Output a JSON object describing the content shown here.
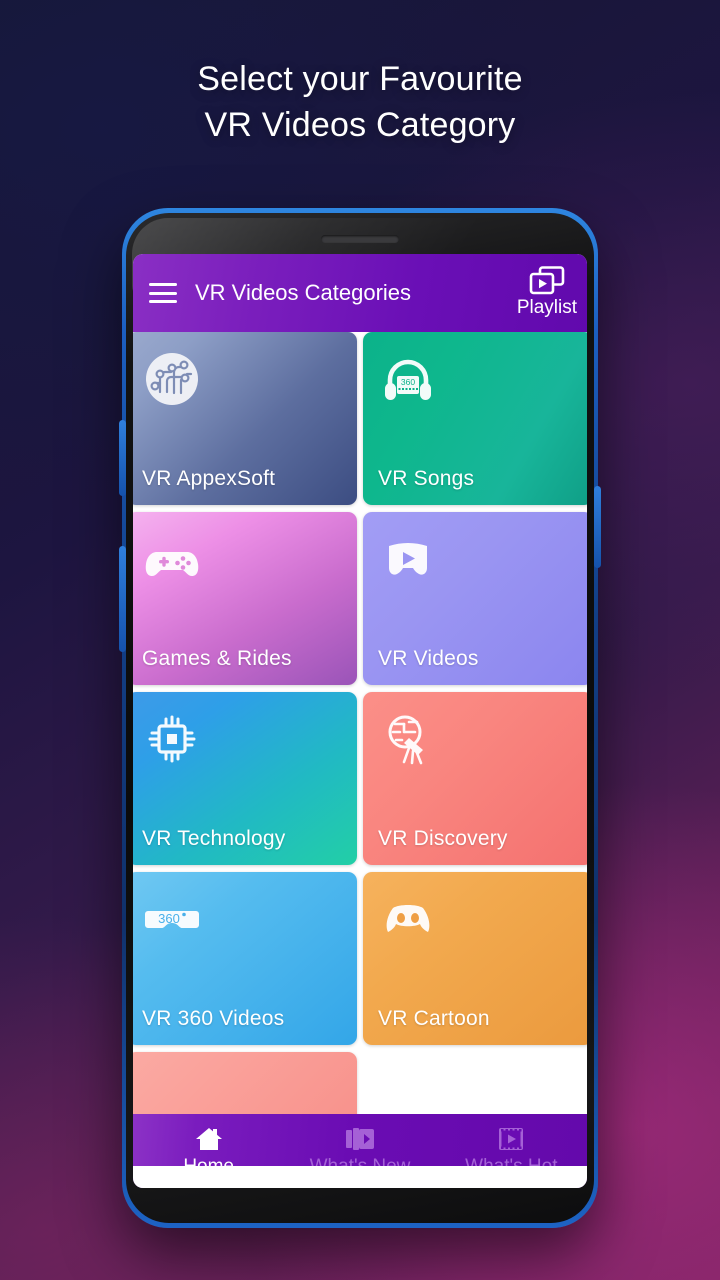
{
  "promo": {
    "headline_line1": "Select your Favourite",
    "headline_line2": "VR Videos Category"
  },
  "app": {
    "appbar": {
      "menu_icon": "hamburger-menu-icon",
      "title": "VR Videos Categories",
      "playlist_icon": "playlist-icon",
      "playlist_label": "Playlist",
      "gradient_from": "#8a2fc4",
      "gradient_to": "#6109ad"
    },
    "categories": [
      {
        "label": "VR AppexSoft",
        "icon": "circuit-board-icon",
        "color_from": "#8d9ec6",
        "color_to": "#3c4d82"
      },
      {
        "label": "VR Songs",
        "icon": "headphones-360-icon",
        "color_from": "#0cb28a",
        "color_to": "#13a88f"
      },
      {
        "label": "Games & Rides",
        "icon": "gamepad-icon",
        "color_from": "#f0a0e8",
        "color_to": "#9a54b8"
      },
      {
        "label": "VR Videos",
        "icon": "vr-screen-play-icon",
        "color_from": "#9a95f2",
        "color_to": "#8b85ef"
      },
      {
        "label": "VR Technology",
        "icon": "cpu-chip-icon",
        "color_from": "#2e9fe8",
        "color_to": "#22cfa6"
      },
      {
        "label": "VR Discovery",
        "icon": "globe-telescope-icon",
        "color_from": "#f9857f",
        "color_to": "#f4716f"
      },
      {
        "label": "VR 360 Videos",
        "icon": "vr-goggles-360-icon",
        "icon_text": "360",
        "color_from": "#62c2f0",
        "color_to": "#33a6e8"
      },
      {
        "label": "VR Cartoon",
        "icon": "cartoon-face-icon",
        "color_from": "#f2a94e",
        "color_to": "#eb9a3e"
      }
    ],
    "partial_row": {
      "left_color_from": "#f9a9a2",
      "left_color_to": "#f78a84",
      "right_color": "#ffffff"
    },
    "bottom_nav": [
      {
        "label": "Home",
        "icon": "home-icon",
        "active": true
      },
      {
        "label": "What's New",
        "icon": "film-play-new-icon",
        "active": false
      },
      {
        "label": "What's Hot",
        "icon": "film-strip-hot-icon",
        "active": false
      }
    ]
  }
}
